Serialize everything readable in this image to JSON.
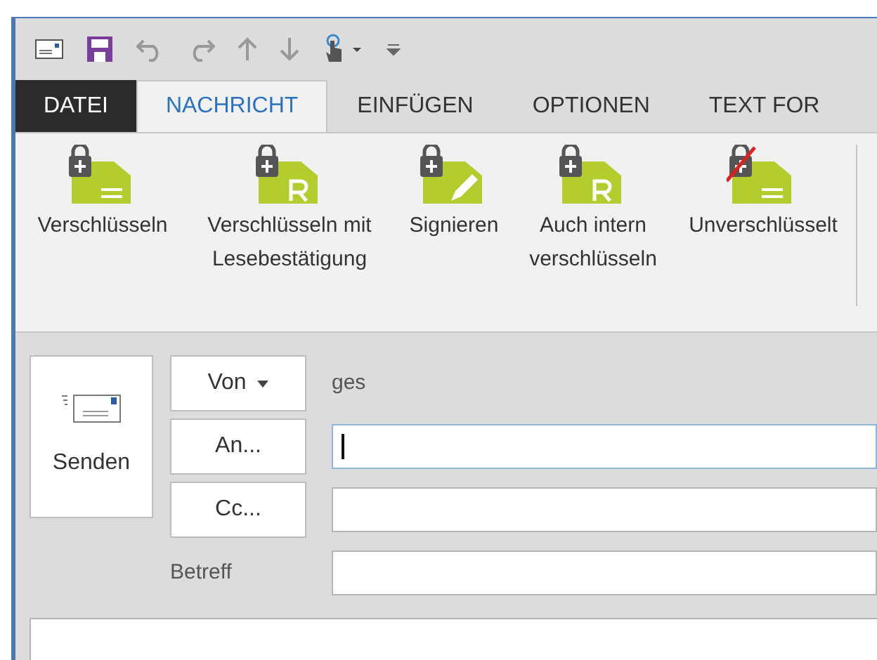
{
  "tabs": [
    {
      "label": "DATEI",
      "kind": "file",
      "selected": false
    },
    {
      "label": "NACHRICHT",
      "kind": "tab",
      "selected": true
    },
    {
      "label": "EINFÜGEN",
      "kind": "tab",
      "selected": false
    },
    {
      "label": "OPTIONEN",
      "kind": "tab",
      "selected": false
    },
    {
      "label": "TEXT FOR",
      "kind": "tab",
      "selected": false
    }
  ],
  "ribbon": [
    {
      "label": "Verschlüsseln",
      "kind": "encrypt"
    },
    {
      "label": "Verschlüsseln mit Lesebestätigung",
      "kind": "receipt"
    },
    {
      "label": "Signieren",
      "kind": "sign"
    },
    {
      "label": "Auch intern verschlüsseln",
      "kind": "receipt"
    },
    {
      "label": "Unverschlüsselt",
      "kind": "unencrypted"
    }
  ],
  "send": {
    "label": "Senden"
  },
  "from": {
    "label": "Von",
    "value": "ges"
  },
  "fields": [
    {
      "label": "An...",
      "kind": "button",
      "focused": true
    },
    {
      "label": "Cc...",
      "kind": "button",
      "focused": false
    },
    {
      "label": "Betreff",
      "kind": "text",
      "focused": false
    }
  ]
}
